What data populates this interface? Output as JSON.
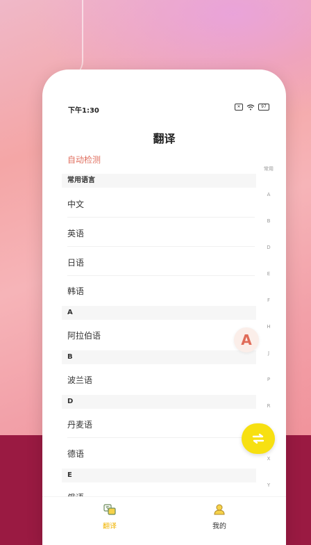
{
  "status": {
    "time": "下午1:30",
    "battery": "97"
  },
  "title": "翻译",
  "auto_detect": "自动检测",
  "sections": [
    {
      "header": "常用语言",
      "items": [
        "中文",
        "英语",
        "日语",
        "韩语"
      ]
    },
    {
      "header": "A",
      "items": [
        "阿拉伯语"
      ]
    },
    {
      "header": "B",
      "items": [
        "波兰语"
      ]
    },
    {
      "header": "D",
      "items": [
        "丹麦语",
        "德语"
      ]
    },
    {
      "header": "E",
      "items": [
        "俄语"
      ]
    }
  ],
  "index_bar": [
    "常用",
    "A",
    "B",
    "D",
    "E",
    "F",
    "H",
    "J",
    "P",
    "R",
    "X",
    "Y"
  ],
  "fab_letter": "A",
  "tabs": [
    {
      "label": "翻译",
      "icon": "translate-icon",
      "active": true
    },
    {
      "label": "我的",
      "icon": "profile-icon",
      "active": false
    }
  ],
  "colors": {
    "accent_red": "#e07060",
    "accent_yellow": "#f7e011",
    "active_tab": "#f1b400"
  }
}
